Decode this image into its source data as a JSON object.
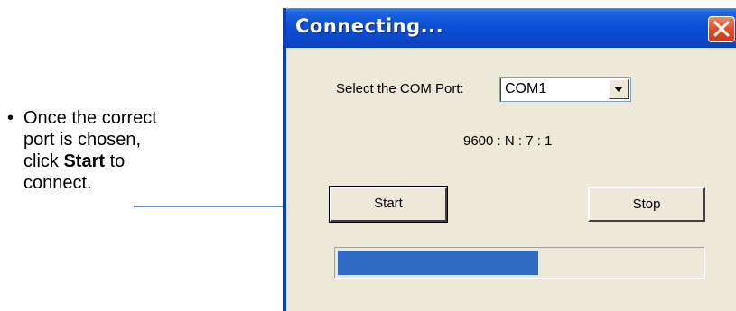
{
  "callout": {
    "bullet": "•",
    "line1": "Once the correct",
    "line2": "port is chosen,",
    "line3_pre": "click ",
    "line3_bold": "Start",
    "line3_post": " to",
    "line4": "connect."
  },
  "window": {
    "title": "Connecting...",
    "close_icon": "close-icon"
  },
  "com_port": {
    "label": "Select the COM Port:",
    "selected": "COM1"
  },
  "settings": "9600 : N : 7 : 1",
  "buttons": {
    "start": "Start",
    "stop": "Stop"
  },
  "progress": {
    "fraction": 0.55,
    "color": "#2f6bc5"
  },
  "colors": {
    "titlebar": "#0b4fd6",
    "window_bg": "#ece9d8",
    "arrow": "#3c5fb0",
    "close_button": "#e2532c"
  }
}
